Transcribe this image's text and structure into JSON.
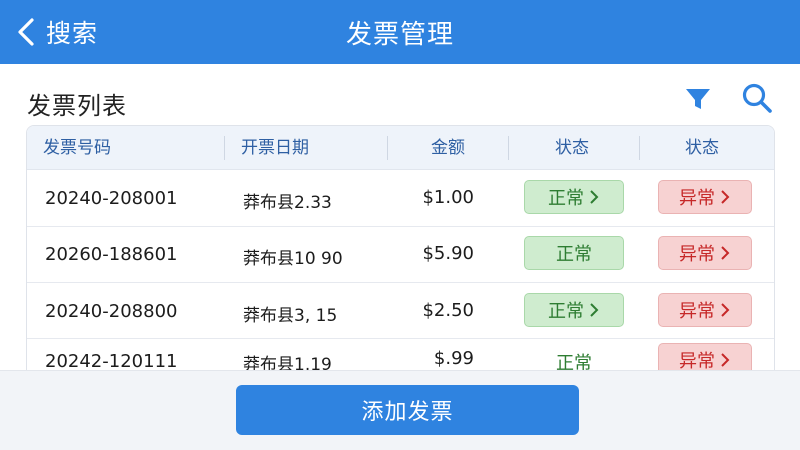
{
  "header": {
    "back_label": "搜索",
    "title": "发票管理"
  },
  "list": {
    "title": "发票列表",
    "filter_icon": "filter-icon",
    "search_icon": "search-icon"
  },
  "table": {
    "columns": [
      "发票号码",
      "开票日期",
      "金额",
      "状态",
      "状态"
    ],
    "rows": [
      {
        "number": "20240-208001",
        "date": "莽布县2.33",
        "amount": "$1.00",
        "status_ok": "正常",
        "status_ok_chevron": true,
        "status_bad": "异常",
        "status_bad_chevron": true
      },
      {
        "number": "20260-188601",
        "date": "莽布县10 90",
        "amount": "$5.90",
        "status_ok": "正常",
        "status_ok_chevron": false,
        "status_bad": "异常",
        "status_bad_chevron": true
      },
      {
        "number": "20240-208800",
        "date": "莽布县3, 15",
        "amount": "$2.50",
        "status_ok": "正常",
        "status_ok_chevron": true,
        "status_bad": "异常",
        "status_bad_chevron": true
      },
      {
        "number": "20242-120111",
        "date": "莽布县1.19",
        "amount": "$.99",
        "status_ok": "正常",
        "status_ok_chevron": false,
        "status_bad": "异常",
        "status_bad_chevron": true
      }
    ]
  },
  "footer": {
    "add_label": "添加发票"
  },
  "colors": {
    "primary": "#2f83e0",
    "ok_bg": "#cfeccf",
    "ok_text": "#2e7d32",
    "bad_bg": "#f7d2d2",
    "bad_text": "#c62828"
  }
}
